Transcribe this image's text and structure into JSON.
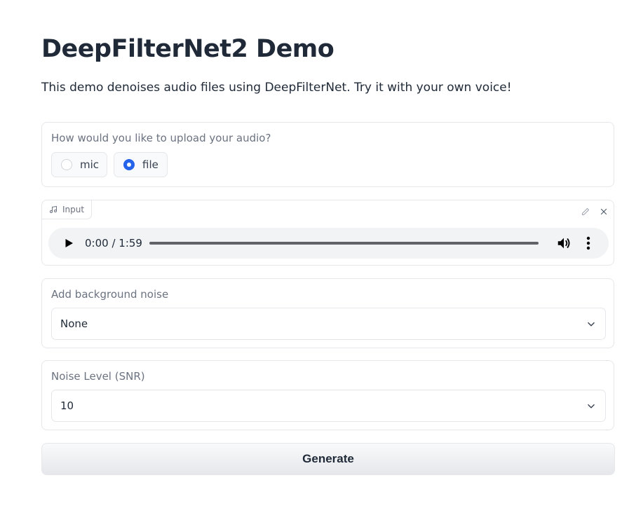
{
  "header": {
    "title": "DeepFilterNet2 Demo",
    "description": "This demo denoises audio files using DeepFilterNet. Try it with your own voice!"
  },
  "upload_mode": {
    "label": "How would you like to upload your audio?",
    "options": [
      {
        "label": "mic",
        "checked": false
      },
      {
        "label": "file",
        "checked": true
      }
    ]
  },
  "audio_input": {
    "tag_label": "Input",
    "tag_icon": "music-note-icon",
    "edit_icon": "pencil-icon",
    "close_icon": "close-icon",
    "player": {
      "time": "0:00 / 1:59",
      "progress": 0,
      "play_icon": "play-icon",
      "volume_icon": "volume-icon",
      "more_icon": "more-vertical-icon"
    }
  },
  "background_noise": {
    "label": "Add background noise",
    "selected": "None",
    "chevron_icon": "chevron-down-icon"
  },
  "noise_level": {
    "label": "Noise Level (SNR)",
    "selected": "10",
    "chevron_icon": "chevron-down-icon"
  },
  "generate": {
    "label": "Generate"
  },
  "colors": {
    "accent": "#2563eb",
    "border": "#e5e7eb",
    "label_text": "#6b7280",
    "player_bg": "#f1f3f4"
  }
}
